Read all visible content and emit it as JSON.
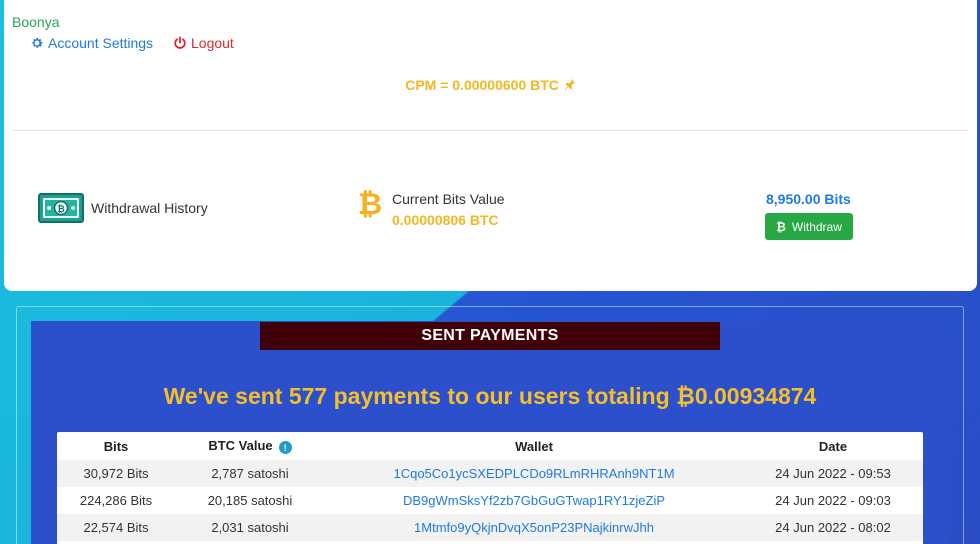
{
  "user": {
    "name": "Boonya"
  },
  "nav": {
    "account_settings": "Account Settings",
    "logout": "Logout"
  },
  "cpm": {
    "text": "CPM = 0.00000600 BTC"
  },
  "stats": {
    "withdrawal_history": "Withdrawal History",
    "current_bits_label": "Current Bits Value",
    "current_bits_value": "0.00000806 BTC",
    "bits_total": "8,950.00 Bits",
    "withdraw_button": "Withdraw"
  },
  "payments": {
    "header": "SENT PAYMENTS",
    "summary": "We've sent 577 payments to our users totaling ₿0.00934874",
    "columns": {
      "bits": "Bits",
      "btc_value": "BTC Value",
      "wallet": "Wallet",
      "date": "Date"
    },
    "rows": [
      {
        "bits": "30,972 Bits",
        "btc_value": "2,787 satoshi",
        "wallet": "1Cqo5Co1ycSXEDPLCDo9RLmRHRAnh9NT1M",
        "date": "24 Jun 2022 - 09:53"
      },
      {
        "bits": "224,286 Bits",
        "btc_value": "20,185 satoshi",
        "wallet": "DB9gWmSksYf2zb7GbGuGTwap1RY1zjeZiP",
        "date": "24 Jun 2022 - 09:03"
      },
      {
        "bits": "22,574 Bits",
        "btc_value": "2,031 satoshi",
        "wallet": "1Mtmfo9yQkjnDvqX5onP23PNajkinrwJhh",
        "date": "24 Jun 2022 - 08:02"
      }
    ]
  },
  "icons": {
    "gear": "gear-icon",
    "power": "power-icon",
    "pin": "pin-icon",
    "money": "money-icon",
    "bitcoin": "bitcoin-icon",
    "info": "info-icon"
  },
  "colors": {
    "accent_gold": "#f2b81f",
    "link_blue": "#1f7ae0",
    "success_green": "#28a745",
    "danger_red": "#e3262a",
    "header_maroon": "#3f0008",
    "panel_blue": "#2c50cc"
  }
}
